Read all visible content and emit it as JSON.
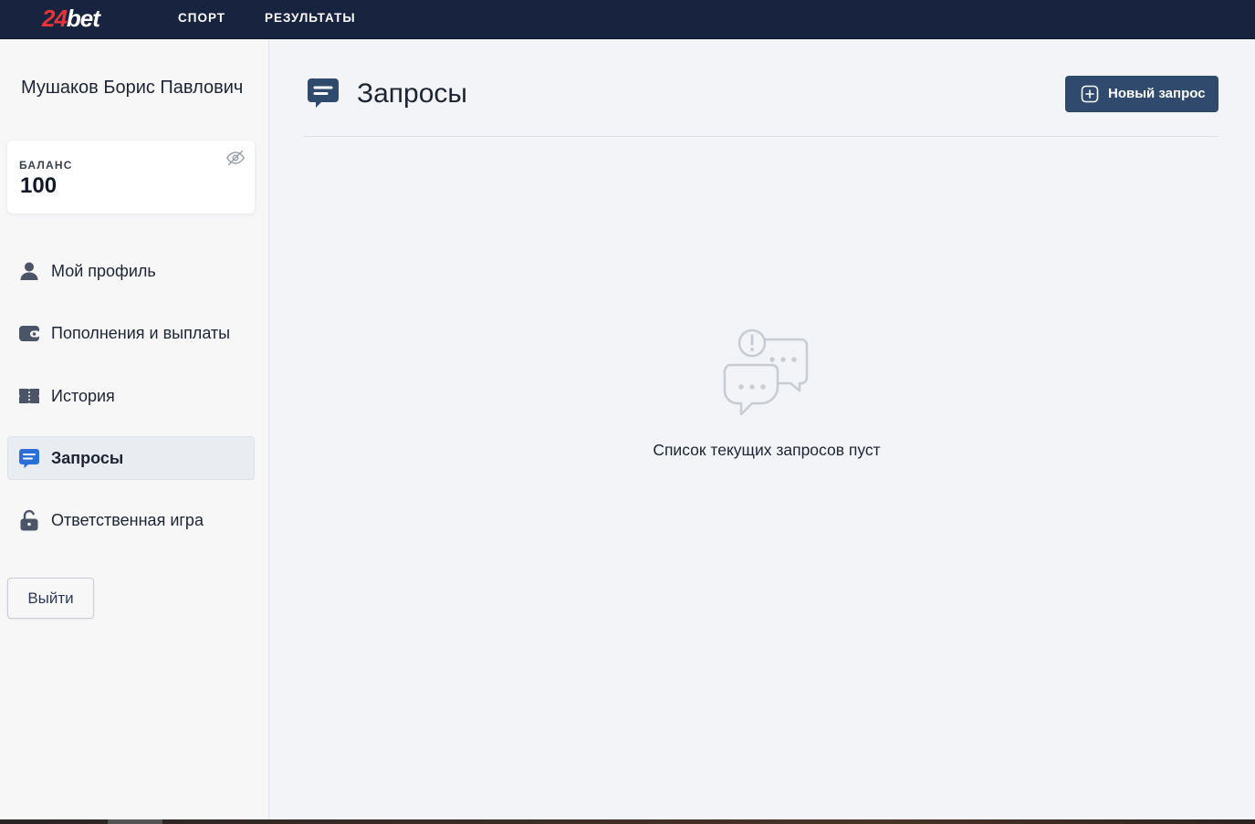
{
  "brand": {
    "logo_num": "24",
    "logo_word": "bet"
  },
  "nav": {
    "sport": "СПОРТ",
    "results": "РЕЗУЛЬТАТЫ"
  },
  "user": {
    "name": "Мушаков Борис Павлович"
  },
  "balance": {
    "label": "БАЛАНС",
    "value": "100",
    "toggle_icon": "eye-off-icon"
  },
  "menu": [
    {
      "label": "Мой профиль",
      "icon": "user-icon",
      "active": false
    },
    {
      "label": "Пополнения и выплаты",
      "icon": "wallet-icon",
      "active": false
    },
    {
      "label": "История",
      "icon": "ticket-icon",
      "active": false
    },
    {
      "label": "Запросы",
      "icon": "chat-icon",
      "active": true
    },
    {
      "label": "Ответственная игра",
      "icon": "lock-icon",
      "active": false
    }
  ],
  "logout": {
    "label": "Выйти"
  },
  "main": {
    "title": "Запросы",
    "new_request_label": "Новый запрос",
    "empty_text": "Список текущих запросов пуст"
  },
  "colors": {
    "topbar": "#18243f",
    "accent": "#2f4a6d",
    "logo_red": "#e8333a",
    "active_icon": "#2a6fd6"
  }
}
